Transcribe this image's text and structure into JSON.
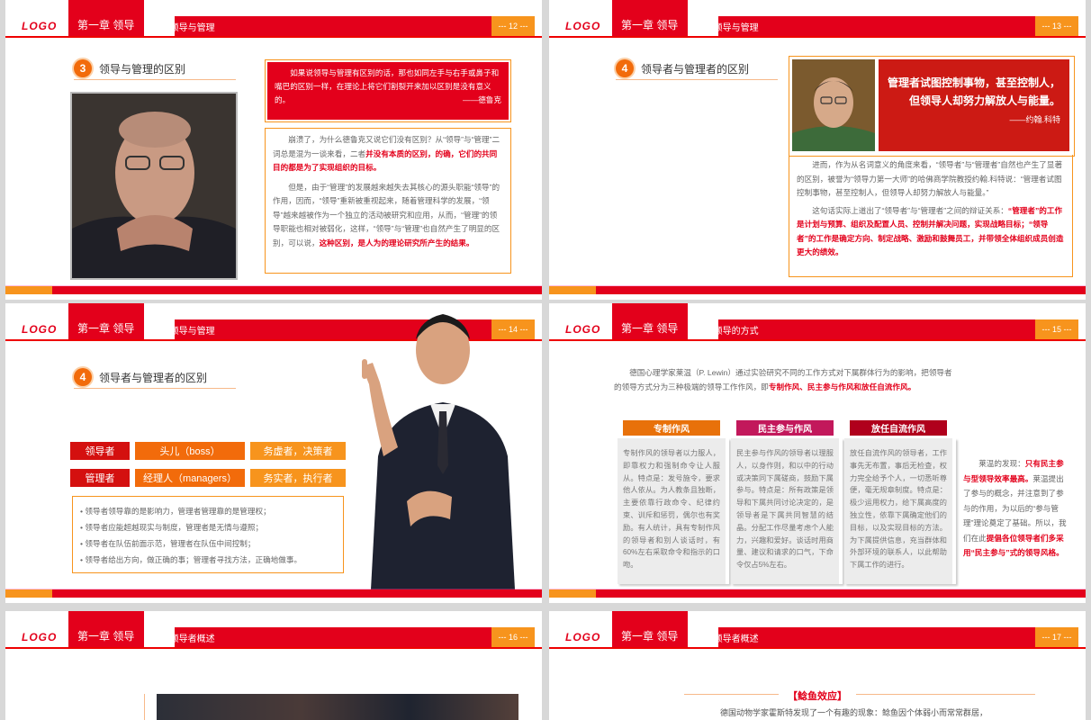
{
  "header": {
    "logo": "LOGO",
    "chapter": "第一章 领导"
  },
  "s12": {
    "subtitle": "1.2 领导与管理",
    "page": "--- 12 ---",
    "section_num": "3",
    "section_title": "领导与管理的区别",
    "quote": "如果说领导与管理有区别的话，那也如同左手与右手或鼻子和嘴巴的区别一样，在理论上将它们割裂开来加以区别是没有意义的。",
    "quote_author": "——德鲁克",
    "p1_a": "崩溃了，为什么德鲁克又说它们没有区别？从“领导”与“管理”二词总是混为一谈来看，二者",
    "p1_red": "并没有本质的区别，的确，它们的共同目的都是为了实现组织的目标。",
    "p2_a": "但是，由于“管理”的发展越来越失去其核心的源头职能“领导”的作用，因而，“领导”重新被重视起来，随着管理科学的发展，“领导”越来越被作为一个独立的活动被研究和应用，从而，“管理”的领导职能也相对被弱化，这样，“领导”与“管理”也自然产生了明显的区别，可以说，",
    "p2_red": "这种区别，是人为的理论研究所产生的结果。"
  },
  "s13": {
    "subtitle": "1.2 领导与管理",
    "page": "--- 13 ---",
    "section_num": "4",
    "section_title": "领导者与管理者的区别",
    "quote": "管理者试图控制事物，甚至控制人，但领导人却努力解放人与能量。",
    "quote_author": "——约翰.科特",
    "p1": "进而，作为从名词意义的角度来看，“领导者”与“管理者”自然也产生了显著的区别，被誉为“领导力第一大师”的哈佛商学院教授约翰.科特说：“管理者试图控制事物，甚至控制人，但领导人却努力解放人与能量。”",
    "p2": "这句话实际上道出了“领导者”与“管理者”之间的辩证关系：",
    "p2_red": "“管理者”的工作是计划与预算、组织及配置人员、控制并解决问题，实现战略目标；“领导者”的工作是确定方向、制定战略、激励和鼓舞员工，并带领全体组织成员创造更大的绩效。"
  },
  "s14": {
    "subtitle": "1.2 领导与管理",
    "page": "--- 14 ---",
    "section_num": "4",
    "section_title": "领导者与管理者的区别",
    "row1": [
      "领导者",
      "头儿（boss）",
      "务虚者，决策者"
    ],
    "row2": [
      "管理者",
      "经理人（managers）",
      "务实者，执行者"
    ],
    "bullets": [
      "领导者领导靠的是影响力，管理者管理靠的是管理权；",
      "领导者应能超越现实与制度，管理者是无情与遵照；",
      "领导者在队伍前面示范，管理者在队伍中间控制；",
      "领导者给出方向，做正确的事；管理者寻找方法，正确地做事。"
    ]
  },
  "s15": {
    "subtitle": "1.3 领导的方式",
    "page": "--- 15 ---",
    "intro": "德国心理学家莱温（P. Lewin）通过实验研究不同的工作方式对下属群体行为的影响，把领导者的领导方式分为三种极端的领导工作作风，即",
    "intro_red": "专制作风、民主参与作风和放任自流作风。",
    "col_titles": [
      "专制作风",
      "民主参与作风",
      "放任自流作风"
    ],
    "col_texts": [
      "专制作风的领导者以力服人，即靠权力和强制命令让人服从。特点是：发号施令，要求他人依从。为人教条且独断，主要依靠行政命令、纪律约束、训斥和惩罚，偶尔也有奖励。有人统计，具有专制作风的领导者和别人谈话时，有60%左右采取命令和指示的口吻。",
      "民主参与作风的领导者以理服人，以身作则，和以中的行动或决策同下属磋商，鼓励下属参与。特点是：所有政策是领导和下属共同讨论决定的，是领导者是下属共同智慧的结晶。分配工作尽量考虑个人能力，兴趣和爱好。谈话时用商量、建议和请求的口气，下命令仅占5%左右。",
      "放任自流作风的领导者，工作事先无布置，事后无检查，权力完全给予个人，一切悉听尊便，毫无规章制度。特点是：极少运用权力，给下属高度的独立性，依靠下属确定他们的目标，以及实现目标的方法。为下属提供信息，充当群体和外部环境的联系人，以此帮助下属工作的进行。"
    ],
    "side_a": "莱温的发现：",
    "side_red1": "只有民主参与型领导效率最高。",
    "side_b": "莱温提出了参与的概念，并注意到了参与的作用，为以后的“参与管理”理论奠定了基础。所以，我们在此",
    "side_red2": "提倡各位领导者们多采用“民主参与”式的领导风格。"
  },
  "s16": {
    "subtitle": "1.4 领导者概述",
    "page": "--- 16 ---"
  },
  "s17": {
    "subtitle": "1.4 领导者概述",
    "page": "--- 17 ---",
    "section_title": "【鲶鱼效应】",
    "text": "德国动物学家霍斯特发现了一个有趣的现象：鲶鱼因个体弱小而常常群居，"
  },
  "colors": {
    "red": "#e3001b",
    "orange": "#f7941d",
    "dark_orange": "#f26b0b",
    "magenta": "#c2185b",
    "dark_red": "#b0001c"
  }
}
